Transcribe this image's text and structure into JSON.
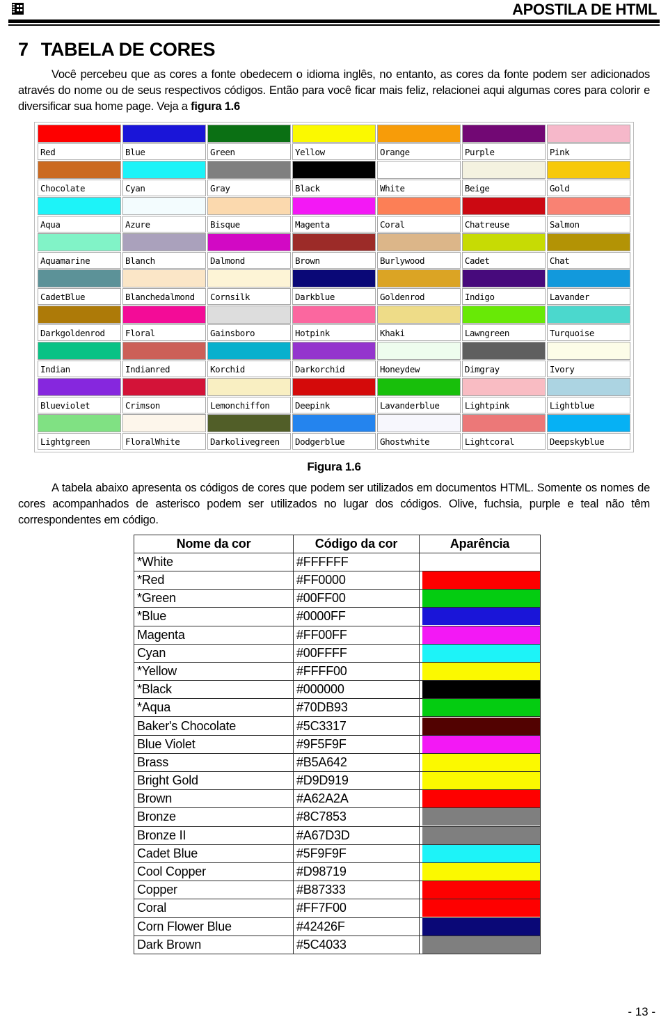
{
  "header": {
    "title": "APOSTILA DE HTML",
    "icon": "book-icon"
  },
  "section": {
    "number": "7",
    "title": "TABELA DE CORES"
  },
  "intro_paragraph": "Você percebeu que as cores a fonte obedecem o idioma inglês, no entanto, as cores da fonte podem ser adicionados através do nome ou de seus respectivos códigos. Então para você ficar mais feliz, relacionei aqui algumas cores para colorir e diversificar sua home page. Veja a ",
  "intro_paragraph_bold": "figura 1.6",
  "figure": {
    "caption": "Figura 1.6",
    "columns": 7,
    "cells": [
      {
        "name": "Red",
        "color": "#FE0000"
      },
      {
        "name": "Blue",
        "color": "#1A15D8"
      },
      {
        "name": "Green",
        "color": "#0B7014"
      },
      {
        "name": "Yellow",
        "color": "#FBF900"
      },
      {
        "name": "Orange",
        "color": "#F79C09"
      },
      {
        "name": "Purple",
        "color": "#720874"
      },
      {
        "name": "Pink",
        "color": "#F6B8CA"
      },
      {
        "name": "Chocolate",
        "color": "#CB6A21"
      },
      {
        "name": "Cyan",
        "color": "#1DF3F8"
      },
      {
        "name": "Gray",
        "color": "#7F7F7F"
      },
      {
        "name": "Black",
        "color": "#000000"
      },
      {
        "name": "White",
        "color": "#FFFFFF"
      },
      {
        "name": "Beige",
        "color": "#F4F2E0"
      },
      {
        "name": "Gold",
        "color": "#F7C90A"
      },
      {
        "name": "Aqua",
        "color": "#1DF3F8"
      },
      {
        "name": "Azure",
        "color": "#F3FCFE"
      },
      {
        "name": "Bisque",
        "color": "#FBD9AE"
      },
      {
        "name": "Magenta",
        "color": "#F318F5"
      },
      {
        "name": "Coral",
        "color": "#FC7F56"
      },
      {
        "name": "Chatreuse",
        "color": "#CC0912"
      },
      {
        "name": "Salmon",
        "color": "#F98273"
      },
      {
        "name": "Aquamarine",
        "color": "#81F3C7"
      },
      {
        "name": "Blanch",
        "color": "#AAA1BC"
      },
      {
        "name": "Dalmond",
        "color": "#D209C4"
      },
      {
        "name": "Brown",
        "color": "#9C2B28"
      },
      {
        "name": "Burlywood",
        "color": "#DCB689"
      },
      {
        "name": "Cadet",
        "color": "#C7DB04"
      },
      {
        "name": "Chat",
        "color": "#B39305"
      },
      {
        "name": "CadetBlue",
        "color": "#5C9298"
      },
      {
        "name": "Blanchedalmond",
        "color": "#FBE6C7"
      },
      {
        "name": "Cornsilk",
        "color": "#FDF4D6"
      },
      {
        "name": "Darkblue",
        "color": "#0A0877"
      },
      {
        "name": "Goldenrod",
        "color": "#DBA424"
      },
      {
        "name": "Indigo",
        "color": "#470A7C"
      },
      {
        "name": "Lavander",
        "color": "#1299DC"
      },
      {
        "name": "Darkgoldenrod",
        "color": "#AD7A08"
      },
      {
        "name": "Floral",
        "color": "#F30C97"
      },
      {
        "name": "Gainsboro",
        "color": "#DDDDDD"
      },
      {
        "name": "Hotpink",
        "color": "#FB679F"
      },
      {
        "name": "Khaki",
        "color": "#EEDC88"
      },
      {
        "name": "Lawngreen",
        "color": "#68E906"
      },
      {
        "name": "Turquoise",
        "color": "#4BD8CD"
      },
      {
        "name": "Indian",
        "color": "#09C285"
      },
      {
        "name": "Indianred",
        "color": "#CC6058"
      },
      {
        "name": "Korchid",
        "color": "#08B0CD"
      },
      {
        "name": "Darkorchid",
        "color": "#9435CD"
      },
      {
        "name": "Honeydew",
        "color": "#EEFCEE"
      },
      {
        "name": "Dimgray",
        "color": "#5F5F5F"
      },
      {
        "name": "Ivory",
        "color": "#FCFCE8"
      },
      {
        "name": "Blueviolet",
        "color": "#8627DE"
      },
      {
        "name": "Crimson",
        "color": "#D31338"
      },
      {
        "name": "Lemonchiffon",
        "color": "#F9EFC2"
      },
      {
        "name": "Deepink",
        "color": "#D40A0A"
      },
      {
        "name": "Lavanderblue",
        "color": "#18BF0B"
      },
      {
        "name": "Lightpink",
        "color": "#F9BCC3"
      },
      {
        "name": "Lightblue",
        "color": "#ACD4E2"
      },
      {
        "name": "Lightgreen",
        "color": "#80E183"
      },
      {
        "name": "FloralWhite",
        "color": "#FDF6EB"
      },
      {
        "name": "Darkolivegreen",
        "color": "#515E28"
      },
      {
        "name": "Dodgerblue",
        "color": "#2484EE"
      },
      {
        "name": "Ghostwhite",
        "color": "#F7F7FD"
      },
      {
        "name": "Lightcoral",
        "color": "#EC7878"
      },
      {
        "name": "Deepskyblue",
        "color": "#06B1F4"
      }
    ]
  },
  "post_figure_paragraph": "A tabela abaixo apresenta os códigos de cores que podem ser utilizados em documentos HTML. Somente os nomes de cores acompanhados de asterisco podem ser utilizados no lugar dos códigos. Olive, fuchsia, purple e teal não têm correspondentes em código.",
  "codes_table": {
    "headers": [
      "Nome da cor",
      "Código da cor",
      "Aparência"
    ],
    "rows": [
      {
        "name": "*White",
        "code": "#FFFFFF",
        "swatch": "#FFFFFF"
      },
      {
        "name": "*Red",
        "code": "#FF0000",
        "swatch": "#FE0000"
      },
      {
        "name": "*Green",
        "code": "#00FF00",
        "swatch": "#04CC11"
      },
      {
        "name": "*Blue",
        "code": "#0000FF",
        "swatch": "#1A15D8"
      },
      {
        "name": "Magenta",
        "code": "#FF00FF",
        "swatch": "#F318F5"
      },
      {
        "name": "Cyan",
        "code": "#00FFFF",
        "swatch": "#1DF3F8"
      },
      {
        "name": "*Yellow",
        "code": "#FFFF00",
        "swatch": "#FBF900"
      },
      {
        "name": "*Black",
        "code": "#000000",
        "swatch": "#000000"
      },
      {
        "name": "*Aqua",
        "code": "#70DB93",
        "swatch": "#04CC11"
      },
      {
        "name": "Baker's Chocolate",
        "code": "#5C3317",
        "swatch": "#520201"
      },
      {
        "name": "Blue Violet",
        "code": "#9F5F9F",
        "swatch": "#F318F5"
      },
      {
        "name": "Brass",
        "code": "#B5A642",
        "swatch": "#FBF900"
      },
      {
        "name": "Bright Gold",
        "code": "#D9D919",
        "swatch": "#FBF900"
      },
      {
        "name": "Brown",
        "code": "#A62A2A",
        "swatch": "#FE0000"
      },
      {
        "name": "Bronze",
        "code": "#8C7853",
        "swatch": "#7F7F7F"
      },
      {
        "name": "Bronze II",
        "code": "#A67D3D",
        "swatch": "#7F7F7F"
      },
      {
        "name": "Cadet Blue",
        "code": "#5F9F9F",
        "swatch": "#1DF3F8"
      },
      {
        "name": "Cool Copper",
        "code": "#D98719",
        "swatch": "#FBF900"
      },
      {
        "name": "Copper",
        "code": "#B87333",
        "swatch": "#FE0000"
      },
      {
        "name": "Coral",
        "code": "#FF7F00",
        "swatch": "#FE0000"
      },
      {
        "name": "Corn Flower Blue",
        "code": "#42426F",
        "swatch": "#0A0877"
      },
      {
        "name": "Dark Brown",
        "code": "#5C4033",
        "swatch": "#7F7F7F"
      }
    ]
  },
  "footer": {
    "page_number": "- 13 -"
  }
}
